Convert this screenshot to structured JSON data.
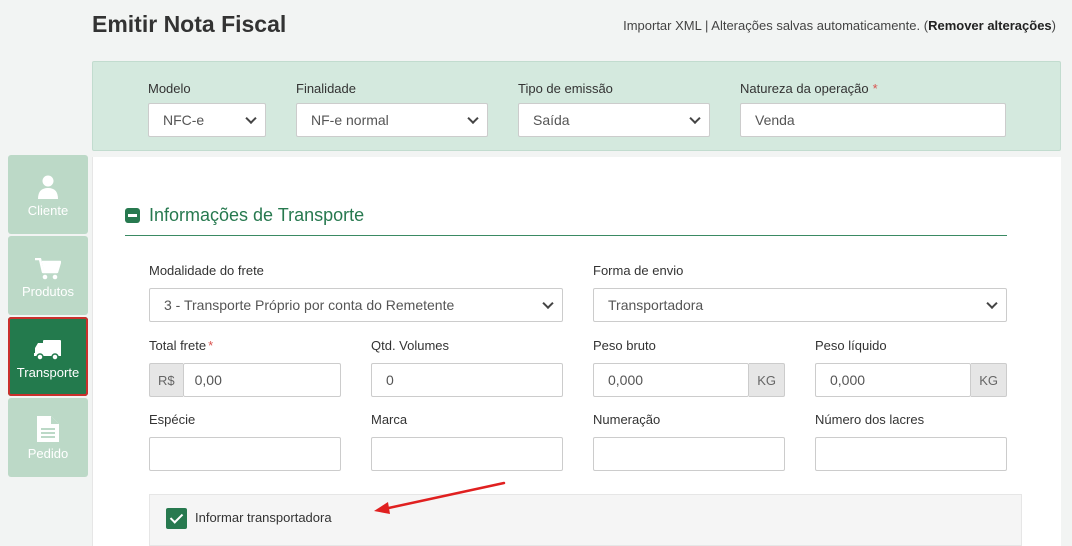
{
  "page": {
    "title": "Emitir Nota Fiscal",
    "actions": {
      "import_xml": "Importar XML",
      "separator": "|",
      "autosave": "Alterações salvas automaticamente.",
      "paren_open": "(",
      "remove": "Remover alterações",
      "paren_close": ")"
    }
  },
  "header": {
    "modelo": {
      "label": "Modelo",
      "value": "NFC-e"
    },
    "finalidade": {
      "label": "Finalidade",
      "value": "NF-e normal"
    },
    "tipo_emissao": {
      "label": "Tipo de emissão",
      "value": "Saída"
    },
    "natureza": {
      "label": "Natureza da operação",
      "required": "*",
      "value": "Venda"
    }
  },
  "sidebar": {
    "items": [
      {
        "label": "Cliente",
        "icon": "user-icon",
        "active": false
      },
      {
        "label": "Produtos",
        "icon": "cart-icon",
        "active": false
      },
      {
        "label": "Transporte",
        "icon": "truck-icon",
        "active": true
      },
      {
        "label": "Pedido",
        "icon": "document-icon",
        "active": false
      }
    ]
  },
  "transport": {
    "section_title": "Informações de Transporte",
    "modalidade": {
      "label": "Modalidade do frete",
      "value": "3 - Transporte Próprio por conta do Remetente"
    },
    "forma_envio": {
      "label": "Forma de envio",
      "value": "Transportadora"
    },
    "total_frete": {
      "label": "Total frete",
      "required": "*",
      "prefix": "R$",
      "value": "0,00"
    },
    "qtd_volumes": {
      "label": "Qtd. Volumes",
      "value": "0"
    },
    "peso_bruto": {
      "label": "Peso bruto",
      "value": "0,000",
      "suffix": "KG"
    },
    "peso_liquido": {
      "label": "Peso líquido",
      "value": "0,000",
      "suffix": "KG"
    },
    "especie": {
      "label": "Espécie",
      "value": ""
    },
    "marca": {
      "label": "Marca",
      "value": ""
    },
    "numeracao": {
      "label": "Numeração",
      "value": ""
    },
    "lacres": {
      "label": "Número dos lacres",
      "value": ""
    },
    "informar_transportadora": {
      "label": "Informar transportadora",
      "checked": true
    }
  },
  "colors": {
    "primary": "#237a4d",
    "header_bg": "#d4e9de",
    "nav_inactive": "#bcd9c7",
    "annotation_red": "#e02020"
  }
}
